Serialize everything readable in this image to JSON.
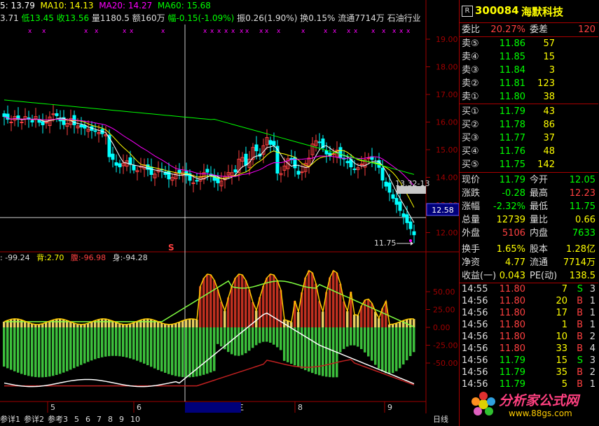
{
  "header": {
    "ma5": "5: 13.79",
    "ma10": "MA10: 14.13",
    "ma20": "MA20: 14.27",
    "ma60": "MA60: 15.68",
    "line2": {
      "open": "3.71",
      "low": "低13.45",
      "close": "收13.56",
      "vol": "量1180.5",
      "amt": "额160万",
      "amp": "幅-0.15(-1.09%)",
      "swing": "振0.26(1.90%)",
      "turn": "换0.15%",
      "float": "流通7714万",
      "sector": "石油行业"
    }
  },
  "price_axis": {
    "ticks": [
      "19.00",
      "18.00",
      "17.00",
      "16.00",
      "15.00",
      "14.00",
      "13.00",
      "12.00"
    ],
    "cursor": "12.58"
  },
  "indicator": {
    "k": ": -99.24",
    "back_label": "背:",
    "back": "2.70",
    "belly_label": "腹:",
    "belly": "-96.98",
    "body_label": "身:",
    "body": "-94.28",
    "ticks": [
      "50.00",
      "25.00",
      "0.00",
      "-25.00",
      "-50.00"
    ]
  },
  "chart_labels": {
    "peak": "13.32-13",
    "low": "11.75",
    "s_marker": "S",
    "x_marker": "x"
  },
  "date_axis": {
    "labels": [
      "5",
      "6",
      "2011/06/22/三",
      "8",
      "9"
    ],
    "period": "日线"
  },
  "bottom_tabs": [
    "参详1",
    "参详2",
    "参考3",
    "5",
    "6",
    "7",
    "8",
    "9",
    "10"
  ],
  "right_panel": {
    "code": "300084",
    "name": "海默科技",
    "weibi_label": "委比",
    "weibi": "20.27%",
    "weicha_label": "委差",
    "weicha": "120",
    "asks": [
      {
        "label": "卖⑤",
        "price": "11.86",
        "vol": "57"
      },
      {
        "label": "卖④",
        "price": "11.85",
        "vol": "15"
      },
      {
        "label": "卖③",
        "price": "11.84",
        "vol": "3"
      },
      {
        "label": "卖②",
        "price": "11.81",
        "vol": "123"
      },
      {
        "label": "卖①",
        "price": "11.80",
        "vol": "38"
      }
    ],
    "bids": [
      {
        "label": "买①",
        "price": "11.79",
        "vol": "43"
      },
      {
        "label": "买②",
        "price": "11.78",
        "vol": "86"
      },
      {
        "label": "买③",
        "price": "11.77",
        "vol": "37"
      },
      {
        "label": "买④",
        "price": "11.76",
        "vol": "48"
      },
      {
        "label": "买⑤",
        "price": "11.75",
        "vol": "142"
      }
    ],
    "stats": [
      {
        "l1": "现价",
        "v1": "11.79",
        "l2": "今开",
        "v2": "12.05",
        "c1": "#00ff00",
        "c2": "#00ff00"
      },
      {
        "l1": "涨跌",
        "v1": "-0.28",
        "l2": "最高",
        "v2": "12.23",
        "c1": "#00ff00",
        "c2": "#ff4040"
      },
      {
        "l1": "涨幅",
        "v1": "-2.32%",
        "l2": "最低",
        "v2": "11.75",
        "c1": "#00ff00",
        "c2": "#00ff00"
      },
      {
        "l1": "总量",
        "v1": "12739",
        "l2": "量比",
        "v2": "0.66",
        "c1": "#ffff00",
        "c2": "#ffff00"
      },
      {
        "l1": "外盘",
        "v1": "5106",
        "l2": "内盘",
        "v2": "7633",
        "c1": "#ff4040",
        "c2": "#00ff00"
      },
      {
        "l1": "换手",
        "v1": "1.65%",
        "l2": "股本",
        "v2": "1.28亿",
        "c1": "#ffff00",
        "c2": "#ffff00"
      },
      {
        "l1": "净资",
        "v1": "4.77",
        "l2": "流通",
        "v2": "7714万",
        "c1": "#ffff00",
        "c2": "#ffff00"
      },
      {
        "l1": "收益(一)",
        "v1": "0.043",
        "l2": "PE(动)",
        "v2": "138.5",
        "c1": "#ffff00",
        "c2": "#ffff00"
      }
    ],
    "ticks": [
      {
        "t": "14:55",
        "p": "11.80",
        "v": "7",
        "s": "S",
        "n": "3"
      },
      {
        "t": "14:56",
        "p": "11.80",
        "v": "20",
        "s": "B",
        "n": "1"
      },
      {
        "t": "14:56",
        "p": "11.80",
        "v": "17",
        "s": "B",
        "n": "1"
      },
      {
        "t": "14:56",
        "p": "11.80",
        "v": "1",
        "s": "B",
        "n": "1"
      },
      {
        "t": "14:56",
        "p": "11.80",
        "v": "10",
        "s": "B",
        "n": "2"
      },
      {
        "t": "14:56",
        "p": "11.80",
        "v": "33",
        "s": "B",
        "n": "4"
      },
      {
        "t": "14:56",
        "p": "11.79",
        "v": "15",
        "s": "S",
        "n": "3"
      },
      {
        "t": "14:56",
        "p": "11.79",
        "v": "35",
        "s": "B",
        "n": "2"
      },
      {
        "t": "14:56",
        "p": "11.79",
        "v": "5",
        "s": "B",
        "n": "1"
      }
    ],
    "watermark": "分析家公式网",
    "watermark_url": "www.88gs.com"
  },
  "colors": {
    "up": "#ff4040",
    "down": "#00ffff",
    "ma5": "#ffffff",
    "ma10": "#ffff00",
    "ma20": "#ff00ff",
    "ma60": "#00ff00",
    "axis": "#a00000"
  }
}
